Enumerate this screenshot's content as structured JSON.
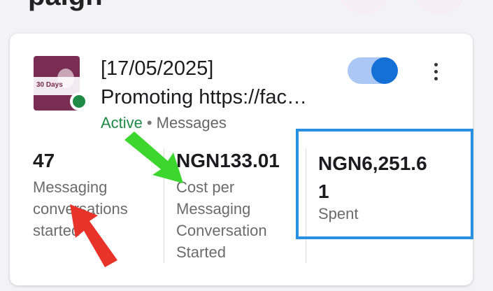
{
  "page": {
    "top_fragment": "paign"
  },
  "campaign": {
    "date": "[17/05/2025]",
    "name": "Promoting https://fac…",
    "status": "Active",
    "separator": "•",
    "objective": "Messages",
    "toggle_on": true,
    "thumbnail_text": "30 Days"
  },
  "metrics": [
    {
      "value": "47",
      "label_lines": [
        "Messaging",
        "conversations",
        "started"
      ]
    },
    {
      "value": "NGN133.01",
      "label_lines": [
        "Cost per",
        "Messaging",
        "Conversation",
        "Started"
      ]
    },
    {
      "value_lines": [
        "NGN6,251.6",
        "1"
      ],
      "label": "Spent"
    }
  ],
  "annotations": {
    "green_arrow_color": "#3dd62f",
    "red_arrow_color": "#e8332b",
    "blue_box_color": "#2790e0"
  },
  "icons": [
    "more-vert-icon",
    "status-dot-icon",
    "toggle-switch"
  ]
}
